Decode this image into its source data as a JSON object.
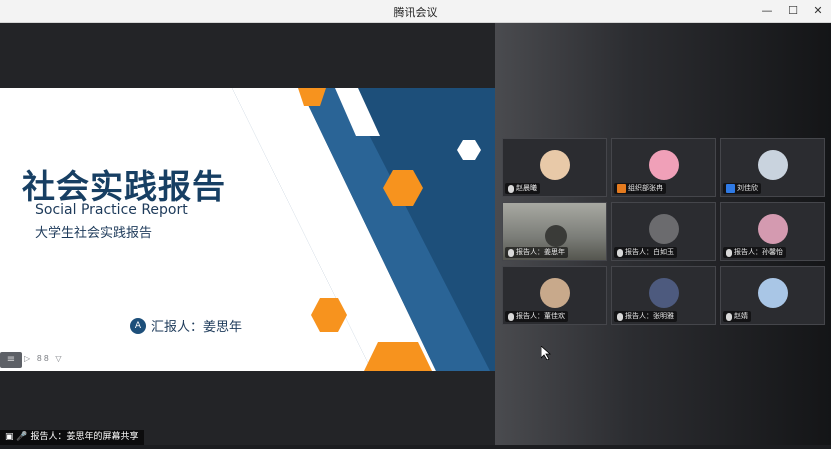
{
  "window": {
    "title": "腾讯会议"
  },
  "slide": {
    "title": "社会实践报告",
    "subtitle_en": "Social Practice Report",
    "subtitle_cn": "大学生社会实践报告",
    "presenter": "汇报人：姜思年",
    "colors": {
      "navy": "#1d4f7a",
      "orange": "#f7931e"
    }
  },
  "ppt_controls": {
    "mini_label": "▷ 88 ▽"
  },
  "share_status": "报告人：姜思年的屏幕共享",
  "participants": [
    {
      "name": "赵晨曦",
      "badge": "none",
      "avatar_color": "#e8c9a8"
    },
    {
      "name": "组织部张冉",
      "badge": "host",
      "avatar_color": "#f0a0b8"
    },
    {
      "name": "刘佳欣",
      "badge": "cohost",
      "avatar_color": "#c9d3de"
    },
    {
      "name": "报告人：姜思年",
      "badge": "none",
      "video": true
    },
    {
      "name": "报告人：白如玉",
      "badge": "none",
      "avatar_color": "#6b6b6e"
    },
    {
      "name": "报告人：孙馨怡",
      "badge": "none",
      "avatar_color": "#d49ab0"
    },
    {
      "name": "报告人：董佳欢",
      "badge": "none",
      "avatar_color": "#c8a98b"
    },
    {
      "name": "报告人：张明雅",
      "badge": "none",
      "avatar_color": "#4d5a7e"
    },
    {
      "name": "赵婧",
      "badge": "none",
      "avatar_color": "#a9c6e6"
    }
  ]
}
